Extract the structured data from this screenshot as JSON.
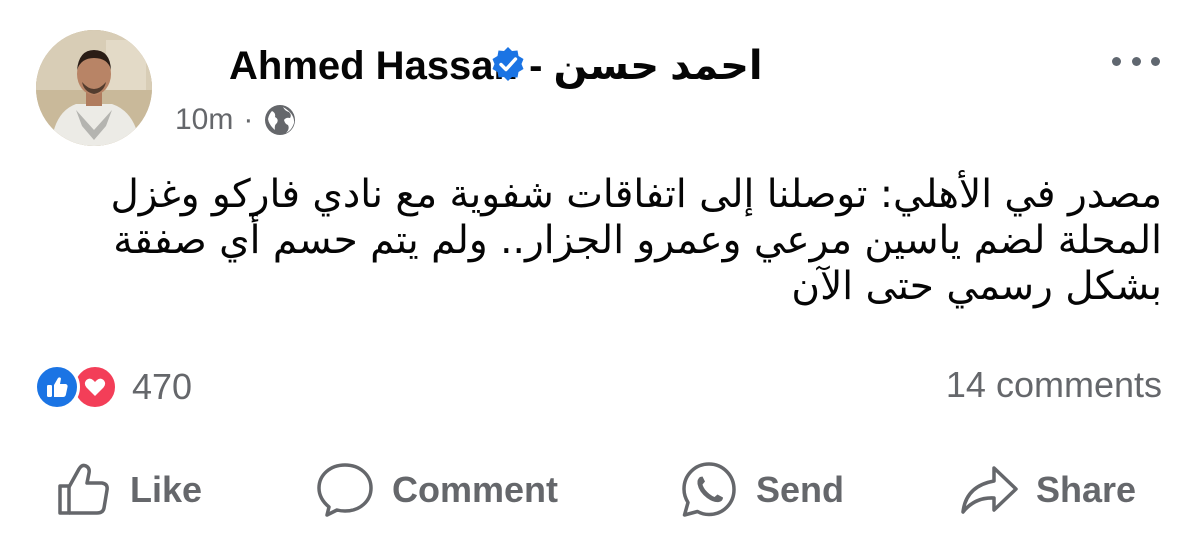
{
  "post": {
    "author": {
      "name": "Ahmed Hassan - احمد حسن",
      "verified": true,
      "avatar_icon": "profile-photo"
    },
    "timestamp": "10m",
    "separator": "·",
    "audience_icon": "globe-icon",
    "text": "مصدر في الأهلي: توصلنا إلى اتفاقات شفوية مع نادي فاركو وغزل المحلة لضم ياسين مرعي وعمرو الجزار.. ولم يتم حسم أي صفقة بشكل رسمي حتى الآن",
    "reactions": {
      "types": [
        "like",
        "love"
      ],
      "count": "470"
    },
    "comments": "14 comments",
    "actions": {
      "like": "Like",
      "comment": "Comment",
      "send": "Send",
      "share": "Share"
    }
  },
  "colors": {
    "verified_blue": "#1b74e4",
    "like_blue": "#1b74e4",
    "love_red": "#f33e58",
    "secondary_text": "#65676b"
  }
}
